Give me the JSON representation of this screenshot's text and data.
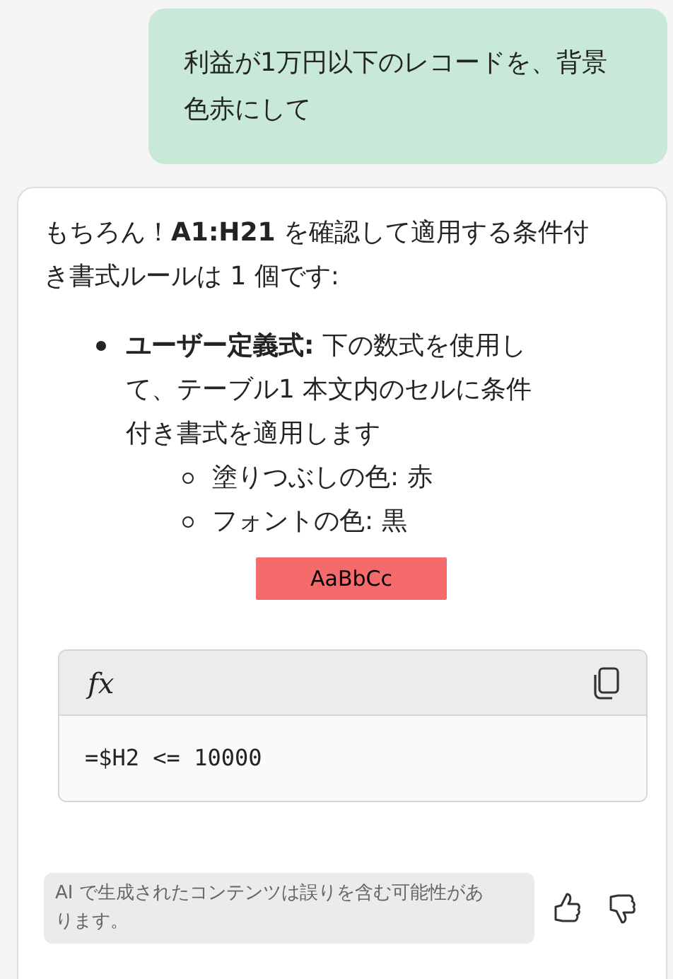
{
  "user_message": {
    "text": "利益が1万円以下のレコードを、背景色赤にして"
  },
  "response": {
    "intro": "もちろん！**A1:H21** を確認して適用する条件付き書式ルールは 1 個です:",
    "rules": [
      {
        "text": "**ユーザー定義式:** 下の数式を使用して、テーブル1 本文内のセルに条件付き書式を適用します",
        "details": [
          "塗りつぶしの色: 赤",
          "フォントの色: 黒"
        ],
        "preview": {
          "text": "AaBbCc",
          "color": "#f56a6a"
        }
      }
    ],
    "formula": {
      "label": "fx",
      "code": "=$H2 <= 10000"
    },
    "disclaimer": "AI で生成されたコンテンツは誤りを含む可能性があります。"
  }
}
